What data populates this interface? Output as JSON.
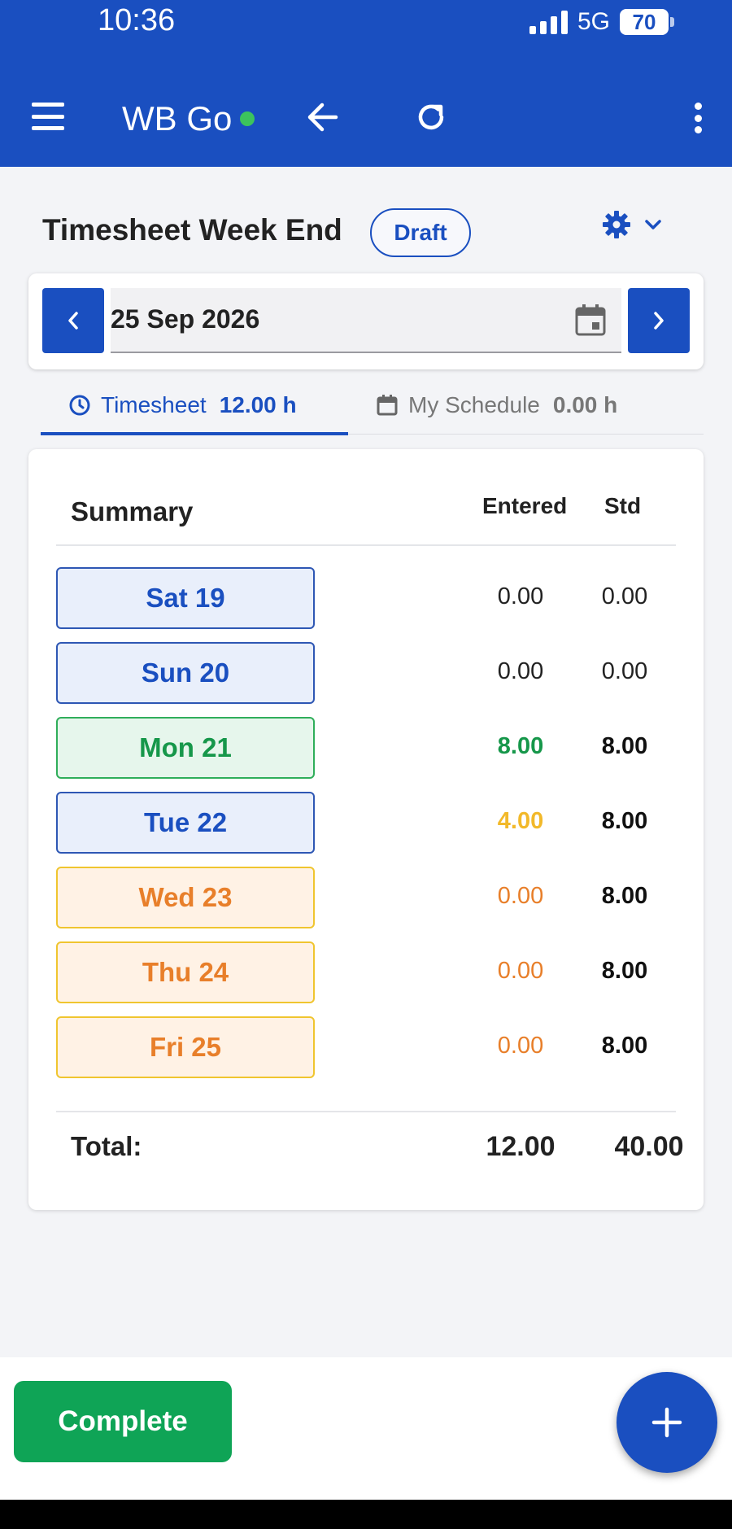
{
  "status_bar": {
    "time": "10:36",
    "network": "5G",
    "battery": "70"
  },
  "app_bar": {
    "title": "WB Go"
  },
  "header": {
    "title": "Timesheet Week End",
    "status": "Draft"
  },
  "date_picker": {
    "value": "25 Sep 2026"
  },
  "tabs": [
    {
      "label": "Timesheet",
      "hours": "12.00 h"
    },
    {
      "label": "My Schedule",
      "hours": "0.00 h"
    }
  ],
  "summary": {
    "title": "Summary",
    "columns": {
      "entered": "Entered",
      "std": "Std"
    },
    "days": [
      {
        "label": "Sat 19",
        "entered": "0.00",
        "std": "0.00"
      },
      {
        "label": "Sun 20",
        "entered": "0.00",
        "std": "0.00"
      },
      {
        "label": "Mon 21",
        "entered": "8.00",
        "std": "8.00"
      },
      {
        "label": "Tue 22",
        "entered": "4.00",
        "std": "8.00"
      },
      {
        "label": "Wed 23",
        "entered": "0.00",
        "std": "8.00"
      },
      {
        "label": "Thu 24",
        "entered": "0.00",
        "std": "8.00"
      },
      {
        "label": "Fri 25",
        "entered": "0.00",
        "std": "8.00"
      }
    ],
    "total": {
      "label": "Total:",
      "entered": "12.00",
      "std": "40.00"
    }
  },
  "actions": {
    "complete_label": "Complete"
  },
  "colors": {
    "brand": "#1a4fc0",
    "complete": "#0fa456",
    "online": "#3cc35d",
    "entered_full": "#16974a",
    "entered_partial": "#f2b92a",
    "entered_missing": "#e87f2a"
  },
  "icons": [
    "menu-icon",
    "back-arrow-icon",
    "refresh-icon",
    "more-vertical-icon",
    "gear-icon",
    "chevron-down-icon",
    "chevron-left-icon",
    "chevron-right-icon",
    "calendar-icon",
    "clock-icon",
    "plus-icon"
  ]
}
